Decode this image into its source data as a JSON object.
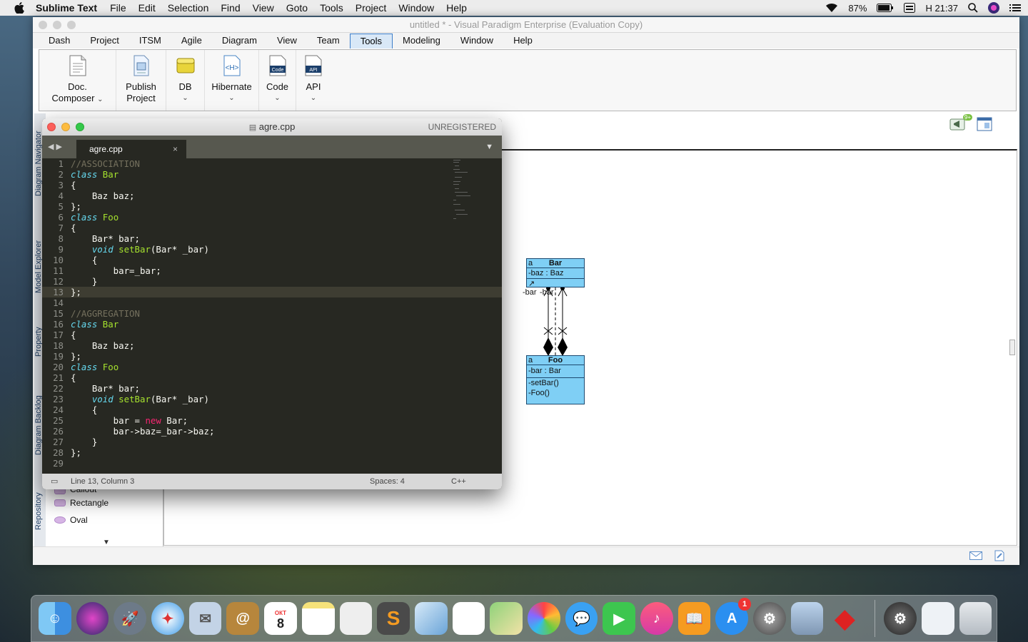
{
  "menubar": {
    "app_name": "Sublime Text",
    "items": [
      "File",
      "Edit",
      "Selection",
      "Find",
      "View",
      "Goto",
      "Tools",
      "Project",
      "Window",
      "Help"
    ],
    "battery": "87%",
    "clock": "Н 21:37"
  },
  "vp": {
    "title": "untitled * - Visual Paradigm Enterprise (Evaluation Copy)",
    "tabs": [
      "Dash",
      "Project",
      "ITSM",
      "Agile",
      "Diagram",
      "View",
      "Team",
      "Tools",
      "Modeling",
      "Window",
      "Help"
    ],
    "active_tab": "Tools",
    "ribbon": {
      "doc_composer": [
        "Doc.",
        "Composer"
      ],
      "publish_project": [
        "Publish",
        "Project"
      ],
      "db": "DB",
      "hibernate": "Hibernate",
      "code": "Code",
      "api": "API",
      "icon_texts": {
        "hibernate": "<H>",
        "code": "Code",
        "api": "API"
      }
    },
    "side_tabs": [
      "Diagram Navigator",
      "Model Explorer",
      "Property",
      "Diagram Backlog",
      "Repository"
    ],
    "shapes": [
      "Callout",
      "Rectangle",
      "Oval"
    ],
    "notification_badge": "9+",
    "diagram": {
      "bar_class": {
        "name": "Bar",
        "stereo": "a",
        "attr": "-baz : Baz"
      },
      "foo_class": {
        "name": "Foo",
        "stereo": "a",
        "attr": "-bar : Bar",
        "ops": [
          "-setBar()",
          "-Foo()"
        ]
      },
      "assoc_label": "-bar",
      "assoc_label2": "-bar"
    }
  },
  "sublime": {
    "title": "agre.cpp",
    "unregistered": "UNREGISTERED",
    "tab_label": "agre.cpp",
    "current_line": 13,
    "lines": [
      [
        {
          "t": "//ASSOCIATION",
          "c": "c-cm"
        }
      ],
      [
        {
          "t": "class",
          "c": "c-kw"
        },
        {
          "t": " "
        },
        {
          "t": "Bar",
          "c": "c-cl"
        }
      ],
      [
        {
          "t": "{"
        }
      ],
      [
        {
          "t": "    Baz baz;"
        }
      ],
      [
        {
          "t": "};"
        }
      ],
      [
        {
          "t": "class",
          "c": "c-kw"
        },
        {
          "t": " "
        },
        {
          "t": "Foo",
          "c": "c-cl"
        }
      ],
      [
        {
          "t": "{"
        }
      ],
      [
        {
          "t": "    Bar* bar;"
        }
      ],
      [
        {
          "t": "    "
        },
        {
          "t": "void",
          "c": "c-kw"
        },
        {
          "t": " "
        },
        {
          "t": "setBar",
          "c": "c-fn"
        },
        {
          "t": "(Bar* _bar)"
        }
      ],
      [
        {
          "t": "    {"
        }
      ],
      [
        {
          "t": "        bar=_bar;"
        }
      ],
      [
        {
          "t": "    }"
        }
      ],
      [
        {
          "t": "};"
        }
      ],
      [
        {
          "t": ""
        }
      ],
      [
        {
          "t": "//AGGREGATION",
          "c": "c-cm"
        }
      ],
      [
        {
          "t": "class",
          "c": "c-kw"
        },
        {
          "t": " "
        },
        {
          "t": "Bar",
          "c": "c-cl"
        }
      ],
      [
        {
          "t": "{"
        }
      ],
      [
        {
          "t": "    Baz baz;"
        }
      ],
      [
        {
          "t": "};"
        }
      ],
      [
        {
          "t": "class",
          "c": "c-kw"
        },
        {
          "t": " "
        },
        {
          "t": "Foo",
          "c": "c-cl"
        }
      ],
      [
        {
          "t": "{"
        }
      ],
      [
        {
          "t": "    Bar* bar;"
        }
      ],
      [
        {
          "t": "    "
        },
        {
          "t": "void",
          "c": "c-kw"
        },
        {
          "t": " "
        },
        {
          "t": "setBar",
          "c": "c-fn"
        },
        {
          "t": "(Bar* _bar)"
        }
      ],
      [
        {
          "t": "    {"
        }
      ],
      [
        {
          "t": "        bar = "
        },
        {
          "t": "new",
          "c": "c-new"
        },
        {
          "t": " Bar;"
        }
      ],
      [
        {
          "t": "        bar->baz=_bar->baz;"
        }
      ],
      [
        {
          "t": "    }"
        }
      ],
      [
        {
          "t": "};"
        }
      ],
      [
        {
          "t": ""
        }
      ]
    ],
    "status": {
      "position": "Line 13, Column 3",
      "spaces": "Spaces: 4",
      "syntax": "C++"
    }
  },
  "dock": {
    "calendar_month": "ОКТ",
    "calendar_day": "8",
    "appstore_badge": "1"
  }
}
